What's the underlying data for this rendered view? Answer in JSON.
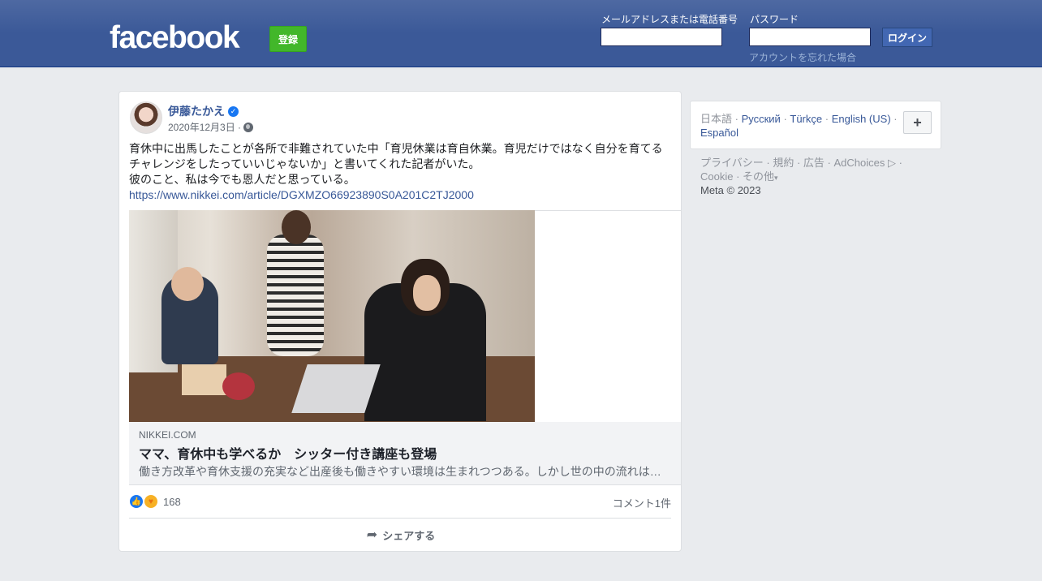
{
  "header": {
    "logo": "facebook",
    "signup_label": "登録",
    "email_label": "メールアドレスまたは電話番号",
    "password_label": "パスワード",
    "login_label": "ログイン",
    "forgot_label": "アカウントを忘れた場合"
  },
  "post": {
    "author": "伊藤たかえ",
    "date": "2020年12月3日 ·",
    "text_lines": [
      "育休中に出馬したことが各所で非難されていた中「育児休業は育自休業。育児だけではなく自分を育てる",
      "チャレンジをしたっていいじゃないか」と書いてくれた記者がいた。",
      "彼のこと、私は今でも恩人だと思っている。"
    ],
    "link_url": "https://www.nikkei.com/article/DGXMZO66923890S0A201C2TJ2000",
    "link_preview": {
      "domain": "NIKKEI.COM",
      "title": "ママ、育休中も学べるか　シッター付き講座も登場",
      "description": "働き方改革や育休支援の充実など出産後も働きやすい環境は生まれつつある。しかし世の中の流れは…"
    },
    "reaction_count": "168",
    "comment_count": "コメント1件",
    "share_label": "シェアする"
  },
  "sidebar": {
    "current_language": "日本語",
    "languages": [
      "Русский",
      "Türkçe",
      "English (US)",
      "Español"
    ],
    "more_button": "+",
    "footer_links": [
      "プライバシー",
      "規約",
      "広告",
      "AdChoices",
      "Cookie",
      "その他"
    ],
    "copyright": "Meta © 2023"
  },
  "colors": {
    "header_blue": "#3b5998",
    "signup_green": "#42b72a",
    "link_blue": "#385898"
  }
}
